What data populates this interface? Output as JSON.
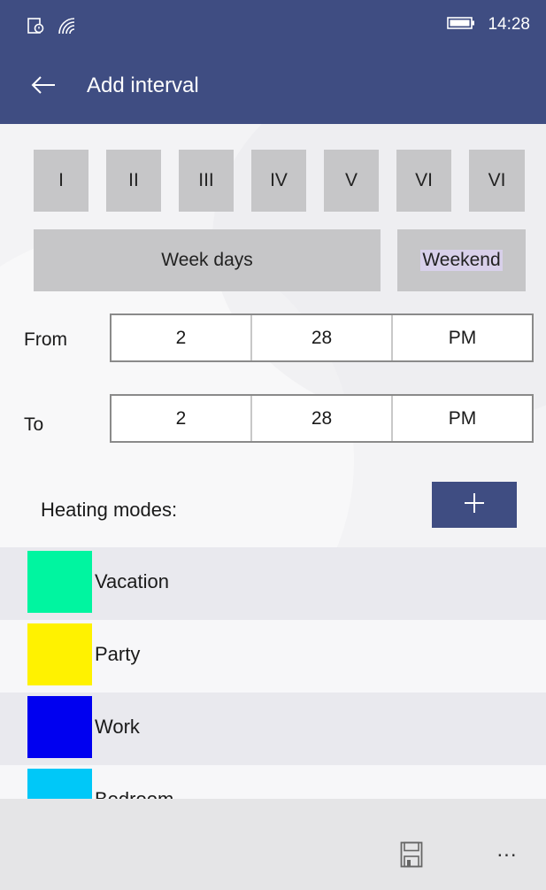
{
  "status_bar": {
    "time": "14:28"
  },
  "header": {
    "title": "Add interval"
  },
  "days": [
    "I",
    "II",
    "III",
    "IV",
    "V",
    "VI",
    "VI"
  ],
  "ranges": {
    "weekdays": "Week days",
    "weekend": "Weekend"
  },
  "from": {
    "label": "From",
    "hour": "2",
    "minute": "28",
    "ampm": "PM"
  },
  "to": {
    "label": "To",
    "hour": "2",
    "minute": "28",
    "ampm": "PM"
  },
  "heating": {
    "label": "Heating modes:",
    "add_symbol": "+"
  },
  "modes": [
    {
      "name": "Vacation",
      "color": "#00f5a0"
    },
    {
      "name": "Party",
      "color": "#fff200"
    },
    {
      "name": "Work",
      "color": "#0000f0"
    },
    {
      "name": "Bedroom",
      "color": "#00c8f8"
    }
  ],
  "app_bar": {
    "more": "..."
  },
  "colors": {
    "accent": "#3f4d82",
    "button_gray": "#c6c6c8"
  }
}
